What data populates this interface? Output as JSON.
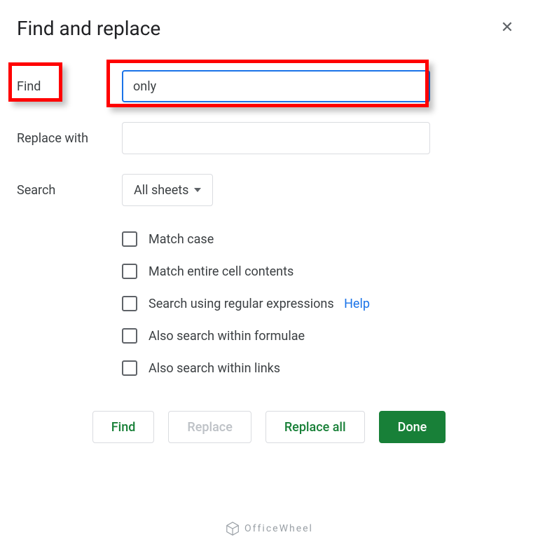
{
  "dialog": {
    "title": "Find and replace",
    "labels": {
      "find": "Find",
      "replace_with": "Replace with",
      "search": "Search"
    },
    "inputs": {
      "find_value": "only",
      "replace_value": ""
    },
    "search_dropdown": {
      "selected": "All sheets"
    },
    "checkboxes": [
      {
        "label": "Match case",
        "checked": false
      },
      {
        "label": "Match entire cell contents",
        "checked": false
      },
      {
        "label": "Search using regular expressions",
        "checked": false,
        "help": "Help"
      },
      {
        "label": "Also search within formulae",
        "checked": false
      },
      {
        "label": "Also search within links",
        "checked": false
      }
    ],
    "buttons": {
      "find": "Find",
      "replace": "Replace",
      "replace_all": "Replace all",
      "done": "Done"
    }
  },
  "watermark": {
    "text": "OfficeWheel"
  },
  "annotations": {
    "highlights": [
      "find-label",
      "find-input"
    ]
  }
}
